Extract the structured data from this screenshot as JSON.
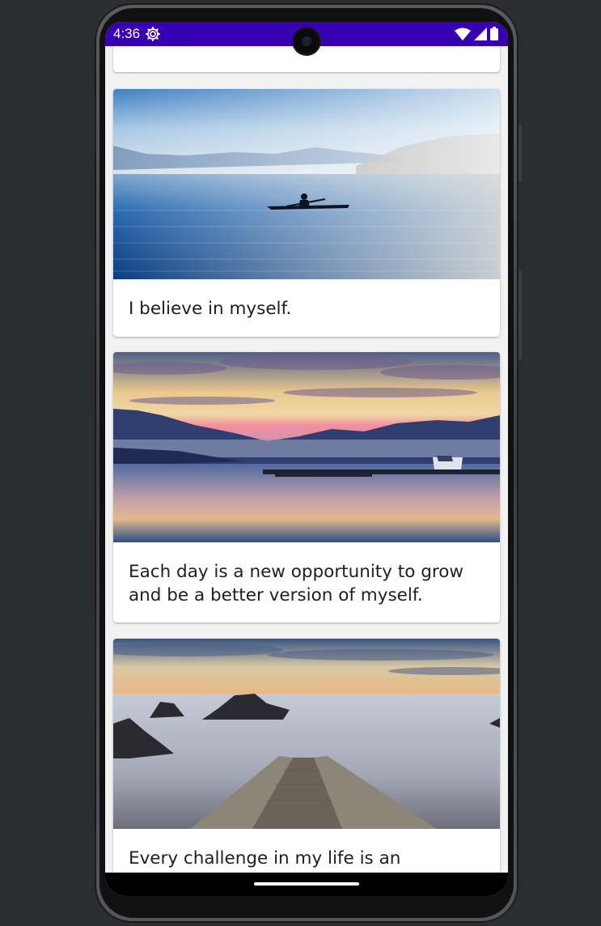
{
  "status_bar": {
    "time": "4:36",
    "background": "#3700b3",
    "icons": [
      "settings-gear-icon",
      "wifi-icon",
      "cellular-signal-icon",
      "battery-icon"
    ]
  },
  "cards": [
    {
      "text": "I believe in myself.",
      "image": "lake-kayaker-photo"
    },
    {
      "text": "Each day is a new opportunity to grow and be a better version of myself.",
      "image": "sunset-lake-dock-photo"
    },
    {
      "text": "Every challenge in my life is an opportunity to learn from.",
      "image": "seaside-ramp-photo"
    }
  ],
  "navigation": {
    "handle": "gesture-home-handle"
  }
}
